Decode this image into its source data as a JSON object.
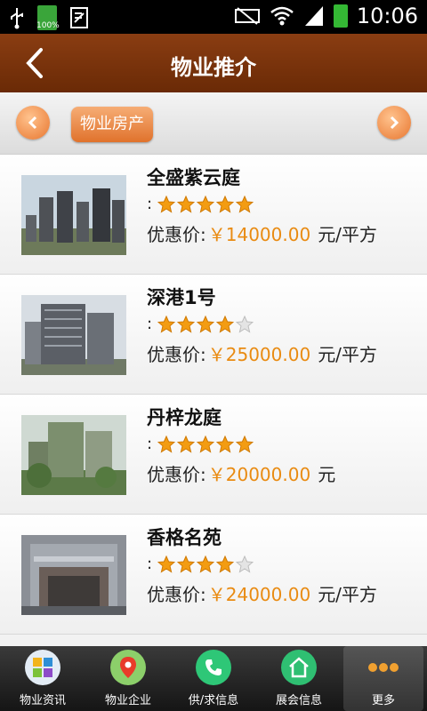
{
  "status_bar": {
    "time": "10:06",
    "battery_level": "100%"
  },
  "header": {
    "title": "物业推介",
    "back_icon": "back-arrow-icon"
  },
  "tabs": {
    "active_label": "物业房产"
  },
  "listings": [
    {
      "name": "全盛紫云庭",
      "rating_prefix": ":",
      "stars": 5,
      "price_label": "优惠价:",
      "price": "￥14000.00",
      "unit": "元/平方"
    },
    {
      "name": "深港1号",
      "rating_prefix": ":",
      "stars": 4,
      "price_label": "优惠价:",
      "price": "￥25000.00",
      "unit": "元/平方"
    },
    {
      "name": "丹梓龙庭",
      "rating_prefix": ":",
      "stars": 5,
      "price_label": "优惠价:",
      "price": "￥20000.00",
      "unit": "元"
    },
    {
      "name": "香格名苑",
      "rating_prefix": ":",
      "stars": 4,
      "price_label": "优惠价:",
      "price": "￥24000.00",
      "unit": "元/平方"
    }
  ],
  "bottom_nav": [
    {
      "label": "物业资讯",
      "icon": "puzzle-icon",
      "color": "#d9e7f4"
    },
    {
      "label": "物业企业",
      "icon": "map-pin-icon",
      "color": "#8ccf6a"
    },
    {
      "label": "供/求信息",
      "icon": "phone-icon",
      "color": "#2ec777"
    },
    {
      "label": "展会信息",
      "icon": "house-icon",
      "color": "#2fbf72"
    },
    {
      "label": "更多",
      "icon": "more-dots-icon",
      "color": "#f0a030"
    }
  ],
  "colors": {
    "header": "#7a330c",
    "accent_orange": "#e8762f",
    "price": "#e98b12",
    "star": "#f39c12"
  }
}
